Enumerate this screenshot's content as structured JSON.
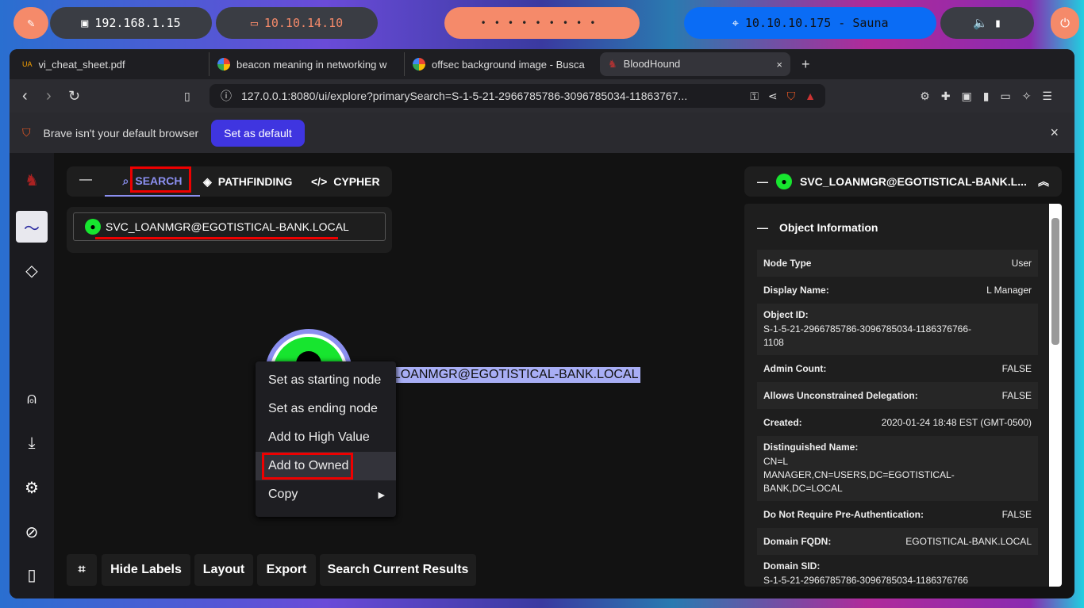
{
  "taskbar": {
    "ip_local": "192.168.1.15",
    "ip_vpn": "10.10.14.10",
    "target": "10.10.10.175 - Sauna"
  },
  "browser": {
    "tabs": [
      {
        "label": "vi_cheat_sheet.pdf"
      },
      {
        "label": "beacon meaning in networking w"
      },
      {
        "label": "offsec background image - Busca"
      },
      {
        "label": "BloodHound"
      }
    ],
    "new_tab": "+",
    "close_tab": "×",
    "url": "127.0.0.1:8080/ui/explore?primarySearch=S-1-5-21-2966785786-3096785034-11863767...",
    "notice": "Brave isn't your default browser",
    "set_default": "Set as default",
    "notice_close": "×"
  },
  "app": {
    "nav_tabs": [
      "SEARCH",
      "PATHFINDING",
      "CYPHER"
    ],
    "search_value": "SVC_LOANMGR@EGOTISTICAL-BANK.LOCAL",
    "node_label": "SVC_LOANMGR@EGOTISTICAL-BANK.LOCAL",
    "context_menu": [
      "Set as starting node",
      "Set as ending node",
      "Add to High Value",
      "Add to Owned",
      "Copy"
    ],
    "bottom_buttons": [
      "Hide Labels",
      "Layout",
      "Export",
      "Search Current Results"
    ],
    "detail": {
      "title": "SVC_LOANMGR@EGOTISTICAL-BANK.L...",
      "section": "Object Information",
      "rows": [
        {
          "k": "Node Type",
          "v": "User"
        },
        {
          "k": "Display Name:",
          "v": "L Manager"
        },
        {
          "k": "Object ID:",
          "v": "S-1-5-21-2966785786-3096785034-1186376766-1108",
          "block": true
        },
        {
          "k": "Admin Count:",
          "v": "FALSE"
        },
        {
          "k": "Allows Unconstrained Delegation:",
          "v": "FALSE"
        },
        {
          "k": "Created:",
          "v": "2020-01-24 18:48 EST (GMT-0500)"
        },
        {
          "k": "Distinguished Name:",
          "v": "CN=L MANAGER,CN=USERS,DC=EGOTISTICAL-BANK,DC=LOCAL",
          "block": true
        },
        {
          "k": "Do Not Require Pre-Authentication:",
          "v": "FALSE"
        },
        {
          "k": "Domain FQDN:",
          "v": "EGOTISTICAL-BANK.LOCAL"
        },
        {
          "k": "Domain SID:",
          "v": "S-1-5-21-2966785786-3096785034-1186376766",
          "block": true
        }
      ]
    }
  },
  "colors": {
    "accent": "#8b8ff0",
    "user_node": "#17e52f",
    "highlight": "#e00000"
  }
}
